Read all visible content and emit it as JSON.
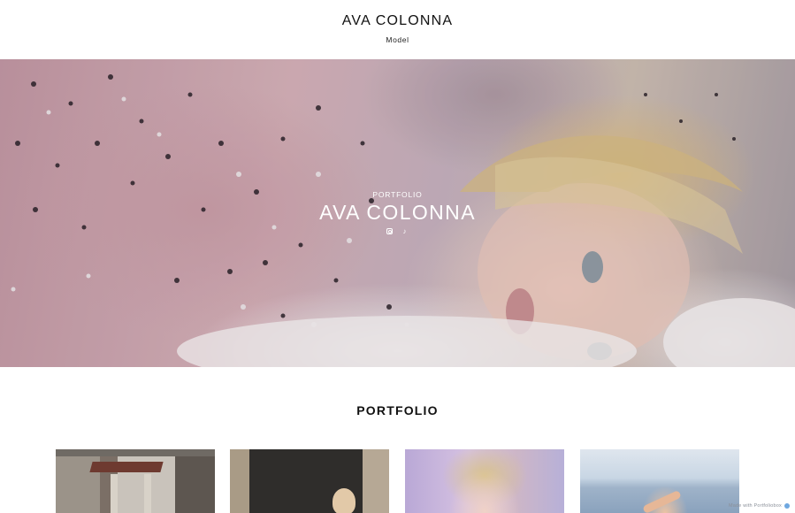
{
  "header": {
    "title": "AVA COLONNA",
    "subtitle": "Model"
  },
  "hero": {
    "kicker": "PORTFOLIO",
    "title": "AVA COLONNA",
    "social": [
      {
        "icon": "instagram-icon"
      },
      {
        "icon": "tiktok-icon",
        "glyph": "♪"
      }
    ]
  },
  "portfolio": {
    "title": "PORTFOLIO",
    "items": [
      {
        "icon": "photo-thumbnail"
      },
      {
        "icon": "photo-thumbnail"
      },
      {
        "icon": "photo-thumbnail"
      },
      {
        "icon": "photo-thumbnail"
      }
    ]
  },
  "footer_badge": {
    "text": "Made with Portfoliobox"
  },
  "colors": {
    "text": "#111111",
    "hero_text": "#ffffff",
    "badge_text": "#8a9099",
    "badge_dot": "#6fa8e0"
  }
}
